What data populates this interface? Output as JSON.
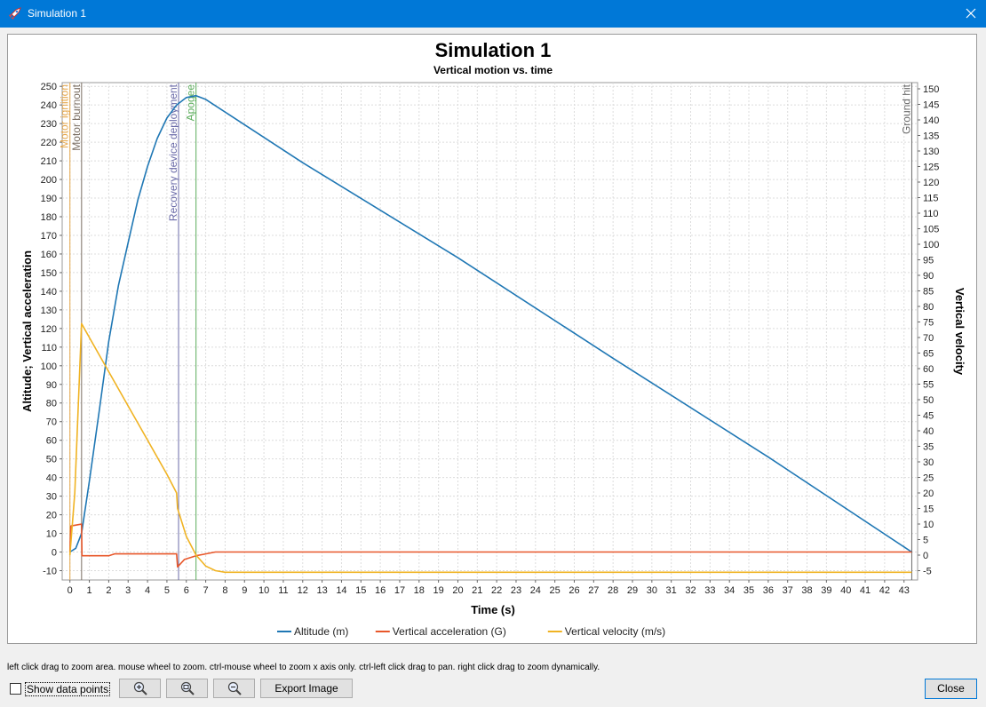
{
  "window": {
    "title": "Simulation 1",
    "accent": "#0078d7"
  },
  "hint": "left click drag to zoom area. mouse wheel to zoom. ctrl-mouse wheel to zoom x axis only. ctrl-left click drag to pan.  right click drag to zoom dynamically.",
  "controls": {
    "show_points_label": "Show data points",
    "show_points_checked": false,
    "zoom_in_icon": "zoom-in-icon",
    "zoom_fit_icon": "zoom-fit-icon",
    "zoom_out_icon": "zoom-out-icon",
    "export_label": "Export Image",
    "close_label": "Close"
  },
  "chart_data": {
    "type": "line",
    "title": "Simulation 1",
    "subtitle": "Vertical motion vs. time",
    "xlabel": "Time (s)",
    "ylabel_left": "Altitude; Vertical acceleration",
    "ylabel_right": "Vertical velocity",
    "xlim": [
      -0.4,
      43.7
    ],
    "ylim_left": [
      -15,
      252
    ],
    "ylim_right": [
      -8,
      152
    ],
    "x_ticks": [
      0,
      1,
      2,
      3,
      4,
      5,
      6,
      7,
      8,
      9,
      10,
      11,
      12,
      13,
      14,
      15,
      16,
      17,
      18,
      19,
      20,
      21,
      22,
      23,
      24,
      25,
      26,
      27,
      28,
      29,
      30,
      31,
      32,
      33,
      34,
      35,
      36,
      37,
      38,
      39,
      40,
      41,
      42,
      43
    ],
    "y_left_ticks": [
      -10,
      0,
      10,
      20,
      30,
      40,
      50,
      60,
      70,
      80,
      90,
      100,
      110,
      120,
      130,
      140,
      150,
      160,
      170,
      180,
      190,
      200,
      210,
      220,
      230,
      240,
      250
    ],
    "y_right_ticks": [
      -5,
      0,
      5,
      10,
      15,
      20,
      25,
      30,
      35,
      40,
      45,
      50,
      55,
      60,
      65,
      70,
      75,
      80,
      85,
      90,
      95,
      100,
      105,
      110,
      115,
      120,
      125,
      130,
      135,
      140,
      145,
      150
    ],
    "grid": true,
    "legend_position": "bottom",
    "series": [
      {
        "name": "Altitude (m)",
        "axis": "left",
        "color": "#1f77b4",
        "points": [
          [
            0,
            0
          ],
          [
            0.3,
            2
          ],
          [
            0.6,
            10
          ],
          [
            1,
            38
          ],
          [
            1.5,
            75
          ],
          [
            2,
            113
          ],
          [
            2.5,
            143
          ],
          [
            3,
            166
          ],
          [
            3.5,
            189
          ],
          [
            4,
            207
          ],
          [
            4.5,
            222
          ],
          [
            5,
            233
          ],
          [
            5.5,
            240
          ],
          [
            6,
            244
          ],
          [
            6.5,
            245
          ],
          [
            7,
            243
          ],
          [
            12,
            209
          ],
          [
            20,
            158
          ],
          [
            28,
            104
          ],
          [
            36,
            51
          ],
          [
            43.4,
            0
          ]
        ]
      },
      {
        "name": "Vertical acceleration (G)",
        "axis": "left",
        "color": "#e8572a",
        "points": [
          [
            0,
            0
          ],
          [
            0.05,
            14
          ],
          [
            0.6,
            15
          ],
          [
            0.62,
            -2
          ],
          [
            2,
            -2
          ],
          [
            2.3,
            -1
          ],
          [
            5.5,
            -1
          ],
          [
            5.55,
            -8
          ],
          [
            5.9,
            -4
          ],
          [
            6.5,
            -2
          ],
          [
            7,
            -1
          ],
          [
            7.5,
            0
          ],
          [
            43.4,
            0
          ]
        ]
      },
      {
        "name": "Vertical velocity (m/s)",
        "axis": "right",
        "color": "#f0b323",
        "points": [
          [
            0,
            0
          ],
          [
            0.25,
            20
          ],
          [
            0.6,
            74.5
          ],
          [
            1,
            70
          ],
          [
            2,
            59
          ],
          [
            3,
            48
          ],
          [
            4,
            37
          ],
          [
            5,
            26
          ],
          [
            5.5,
            20
          ],
          [
            5.55,
            15
          ],
          [
            6,
            6
          ],
          [
            6.5,
            0
          ],
          [
            7,
            -3.5
          ],
          [
            7.5,
            -5
          ],
          [
            8,
            -5.5
          ],
          [
            43.4,
            -5.5
          ]
        ]
      }
    ],
    "events": [
      {
        "label": "Motor ignition",
        "x": 0,
        "color": "#e5a64a"
      },
      {
        "label": "Motor burnout",
        "x": 0.6,
        "color": "#7a6e62"
      },
      {
        "label": "Recovery device deployment",
        "x": 5.6,
        "color": "#6a6aa8"
      },
      {
        "label": "Apogee",
        "x": 6.5,
        "color": "#5cad5c"
      },
      {
        "label": "Ground hit",
        "x": 43.4,
        "color": "#6a6a6a"
      }
    ]
  }
}
